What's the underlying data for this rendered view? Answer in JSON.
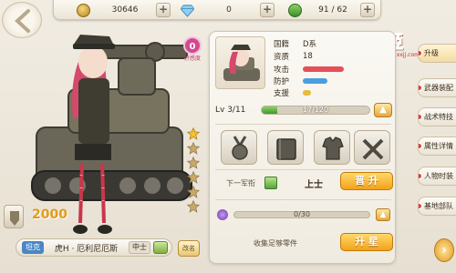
{
  "resources": {
    "gold": "30646",
    "diamond": "0",
    "fuel": "91 / 62"
  },
  "logo": {
    "title": "小小军姬",
    "subtitle": "www.xxjj.com"
  },
  "favorability": {
    "value": "0",
    "label": "好感度"
  },
  "stars": {
    "total": 6,
    "filled": 1
  },
  "power": "2000",
  "unit": {
    "type": "坦克",
    "name": "虎H · 厄利尼厄斯",
    "rank_tag": "中士"
  },
  "info": {
    "nation_key": "国籍",
    "nation_val": "D系",
    "aptitude_key": "资质",
    "aptitude_val": "18",
    "attack_key": "攻击",
    "defense_key": "防护",
    "support_key": "支援",
    "attack": 0.75,
    "defense": 0.45,
    "support": 0.15,
    "colors": {
      "attack": "#e4505a",
      "defense": "#4a9ee0",
      "support": "#e8b93a"
    }
  },
  "level": {
    "label": "Lv 3/11",
    "exp": "17/120",
    "exp_fraction": 0.14
  },
  "equipment": [
    "medal-icon",
    "book-icon",
    "uniform-icon",
    "weapons-icon"
  ],
  "rank": {
    "label": "下一军衔",
    "value": "上士",
    "button": "晋 升"
  },
  "parts": {
    "progress": "0/30",
    "collect_label": "收集足够零件",
    "button": "升 星"
  },
  "tabs": [
    {
      "label": "升级",
      "active": true
    },
    {
      "label": "武器装配",
      "active": false
    },
    {
      "label": "战术特技",
      "active": false
    },
    {
      "label": "属性详情",
      "active": false
    },
    {
      "label": "人物时装",
      "active": false
    },
    {
      "label": "基地部队",
      "active": false
    }
  ],
  "rename_label": "改名"
}
